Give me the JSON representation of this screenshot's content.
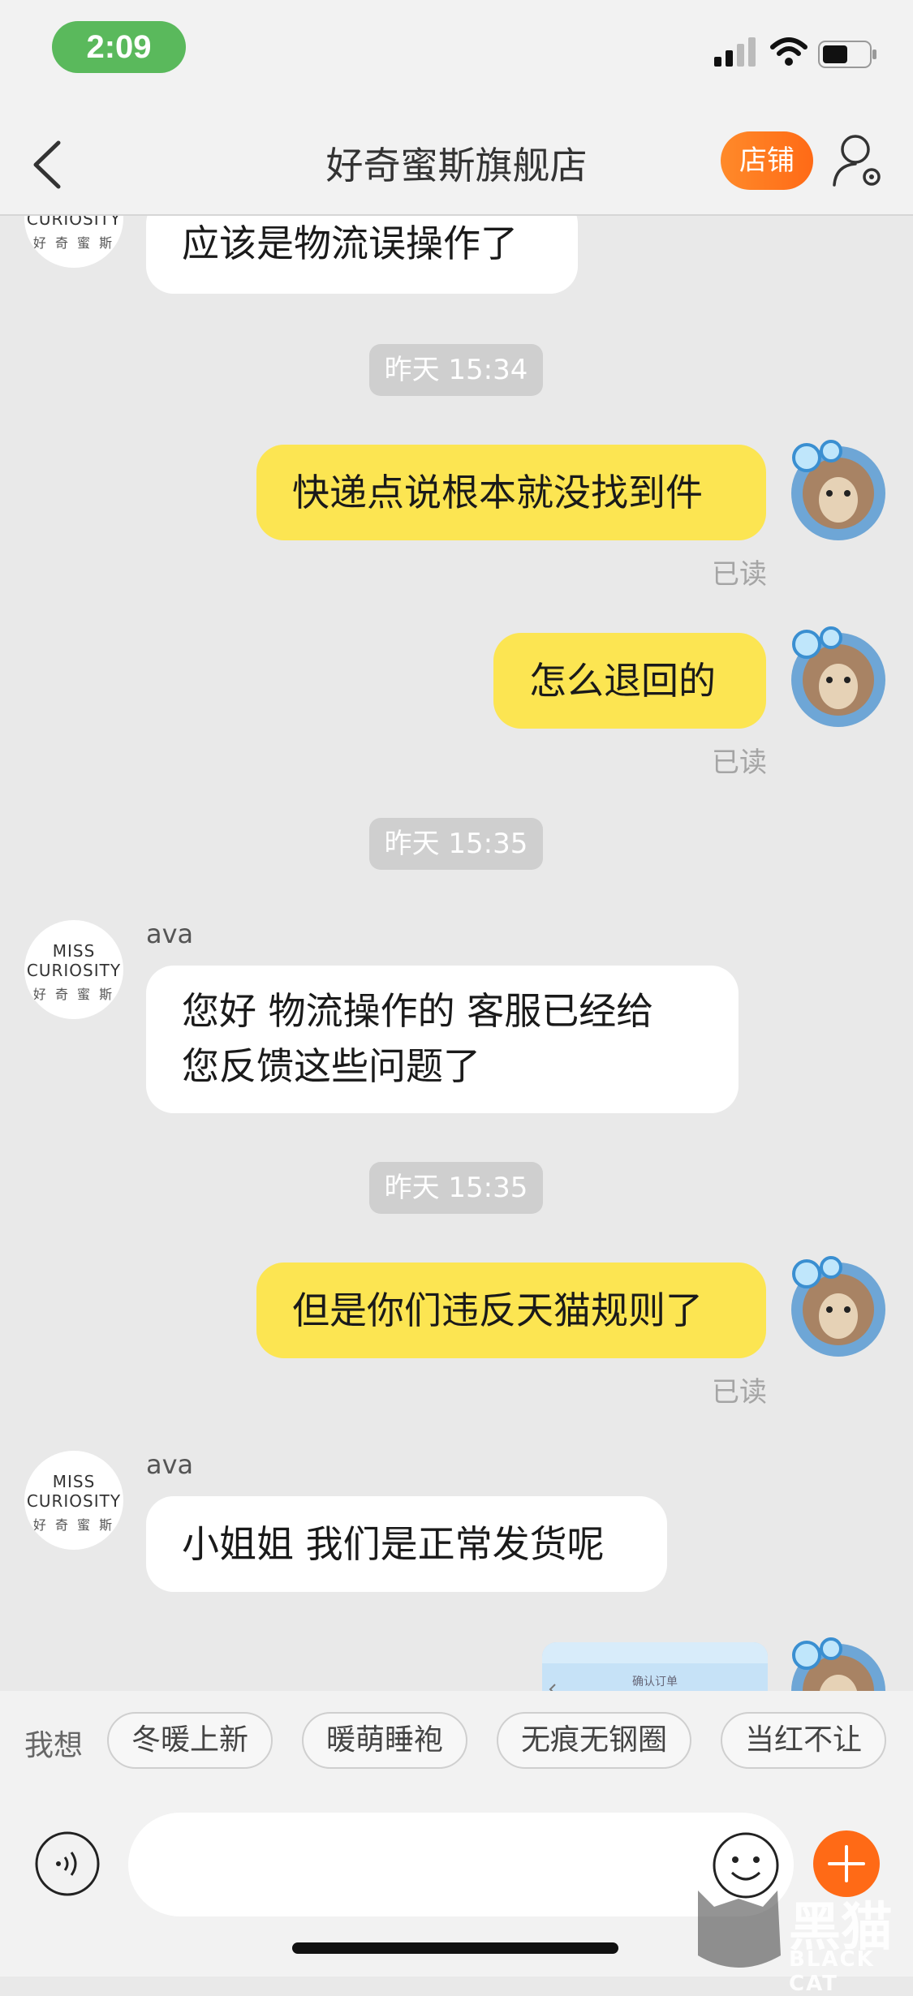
{
  "status_bar": {
    "time": "2:09"
  },
  "nav": {
    "title": "好奇蜜斯旗舰店",
    "shop_button": "店铺"
  },
  "shop_logo": {
    "line1": "MISS",
    "line2": "CURIOSITY",
    "line3": "好 奇 蜜 斯"
  },
  "messages": [
    {
      "type": "incoming",
      "text": "应该是物流误操作了"
    },
    {
      "type": "timestamp",
      "text": "昨天 15:34"
    },
    {
      "type": "outgoing",
      "text": "快递点说根本就没找到件",
      "status": "已读"
    },
    {
      "type": "outgoing",
      "text": "怎么退回的",
      "status": "已读"
    },
    {
      "type": "timestamp",
      "text": "昨天 15:35"
    },
    {
      "type": "incoming",
      "sender": "ava",
      "lines": [
        "您好 物流操作的 客服已经给",
        "您反馈这些问题了"
      ]
    },
    {
      "type": "timestamp",
      "text": "昨天 15:35"
    },
    {
      "type": "outgoing",
      "text": "但是你们违反天猫规则了",
      "status": "已读"
    },
    {
      "type": "incoming",
      "sender": "ava",
      "text": "小姐姐 我们是正常发货呢"
    },
    {
      "type": "outgoing-image",
      "text": "确认订单"
    }
  ],
  "quick_bar": {
    "label": "我想",
    "chips": [
      "冬暖上新",
      "暖萌睡袍",
      "无痕无钢圈",
      "当红不让"
    ]
  },
  "watermark": {
    "text": "黑猫",
    "sub": "BLACK CAT"
  },
  "colors": {
    "outgoing_bubble": "#fce552",
    "accent": "#ff6a16",
    "time_pill": "#5ab95c"
  }
}
